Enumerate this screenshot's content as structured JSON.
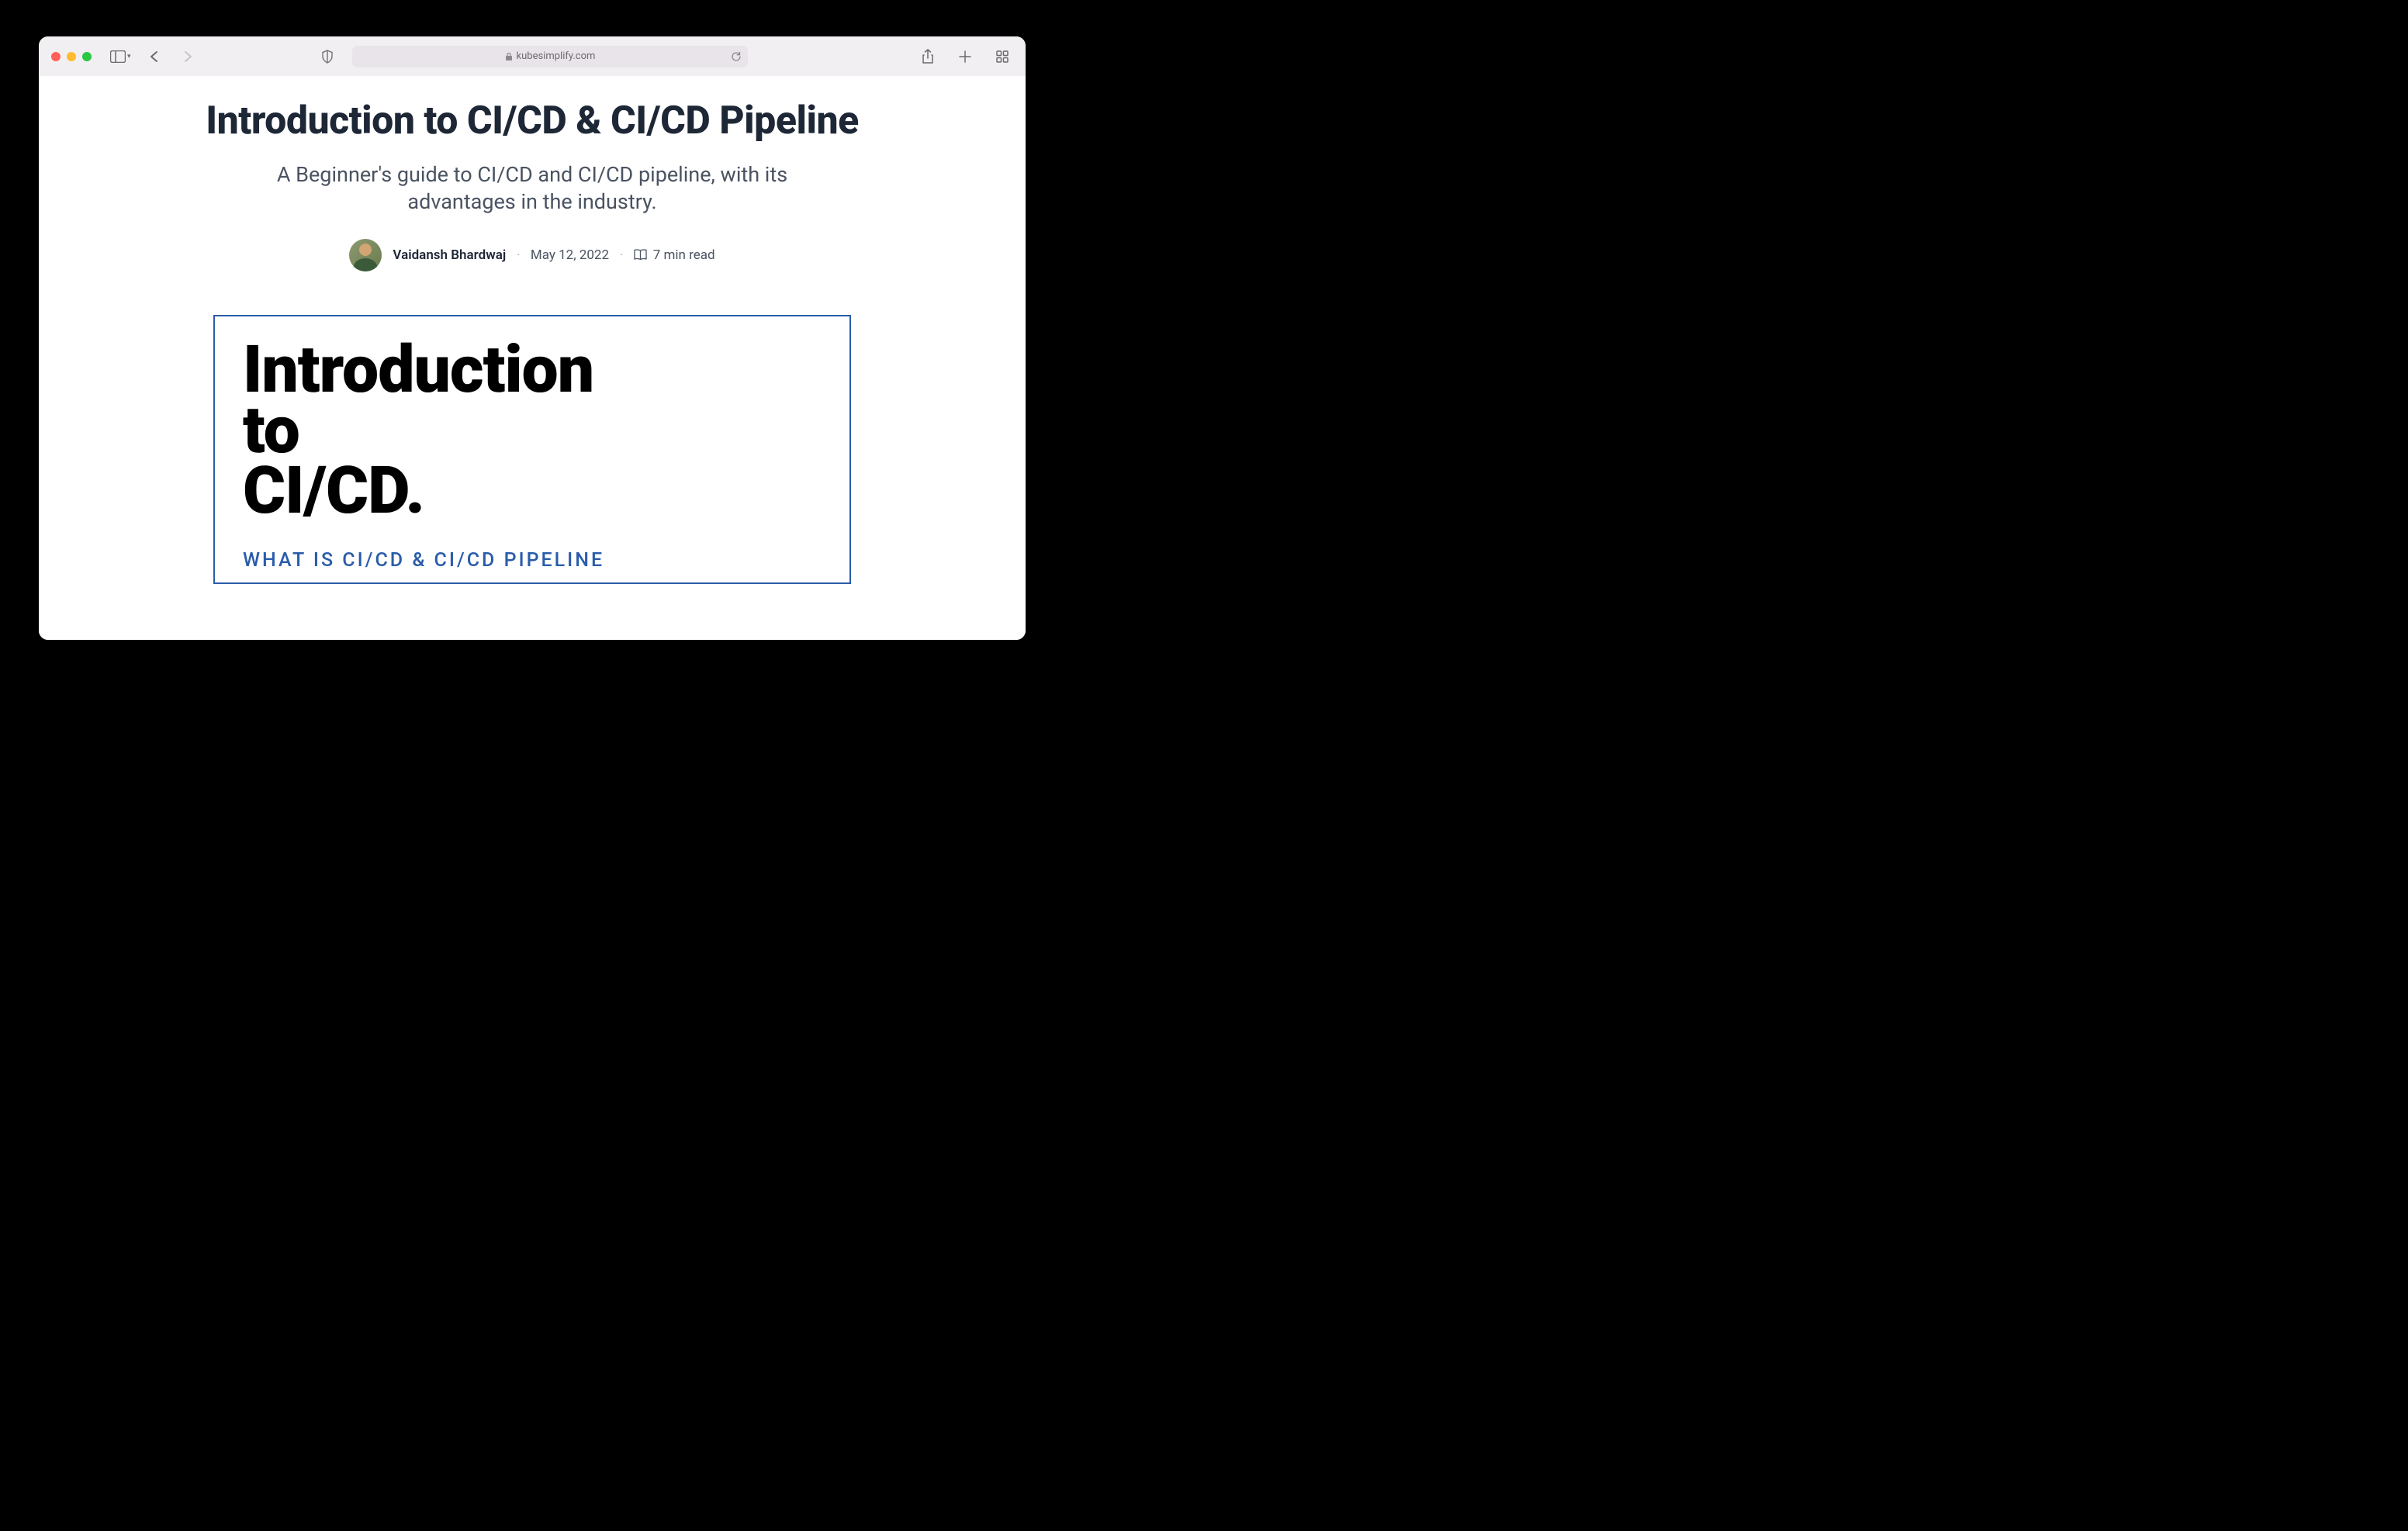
{
  "browser": {
    "url": "kubesimplify.com"
  },
  "article": {
    "title": "Introduction to CI/CD & CI/CD Pipeline",
    "subtitle": "A Beginner's guide to CI/CD and CI/CD pipeline, with its advantages in the industry.",
    "author": "Vaidansh Bhardwaj",
    "date": "May 12, 2022",
    "read_time": "7 min read"
  },
  "hero": {
    "line1": "Introduction",
    "line2": "to",
    "line3": "CI/CD.",
    "subtitle": "WHAT IS CI/CD & CI/CD PIPELINE"
  }
}
